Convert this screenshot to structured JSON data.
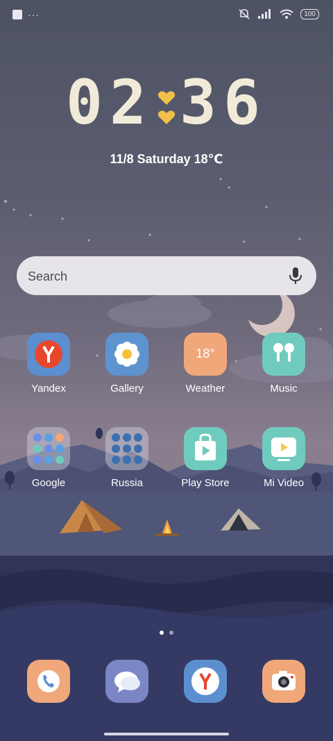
{
  "status_bar": {
    "more_indicator": "···",
    "battery": "100"
  },
  "clock": {
    "hours": "02",
    "minutes": "36"
  },
  "date": {
    "text": "11/8  Saturday  18℃"
  },
  "search": {
    "placeholder": "Search"
  },
  "apps_row1": [
    {
      "label": "Yandex",
      "color": "#5b8fd0"
    },
    {
      "label": "Gallery",
      "color": "#5d93cf"
    },
    {
      "label": "Weather",
      "color": "#f0a77a",
      "badge": "18°"
    },
    {
      "label": "Music",
      "color": "#6fcbbd"
    }
  ],
  "apps_row2": [
    {
      "label": "Google"
    },
    {
      "label": "Russia"
    },
    {
      "label": "Play Store",
      "color": "#6fcbbd"
    },
    {
      "label": "Mi Video",
      "color": "#6fcbbd"
    }
  ],
  "page_indicator": {
    "count": 2,
    "active": 1
  },
  "dock": [
    "phone-icon",
    "messages-icon",
    "yandex-browser-icon",
    "camera-icon"
  ]
}
